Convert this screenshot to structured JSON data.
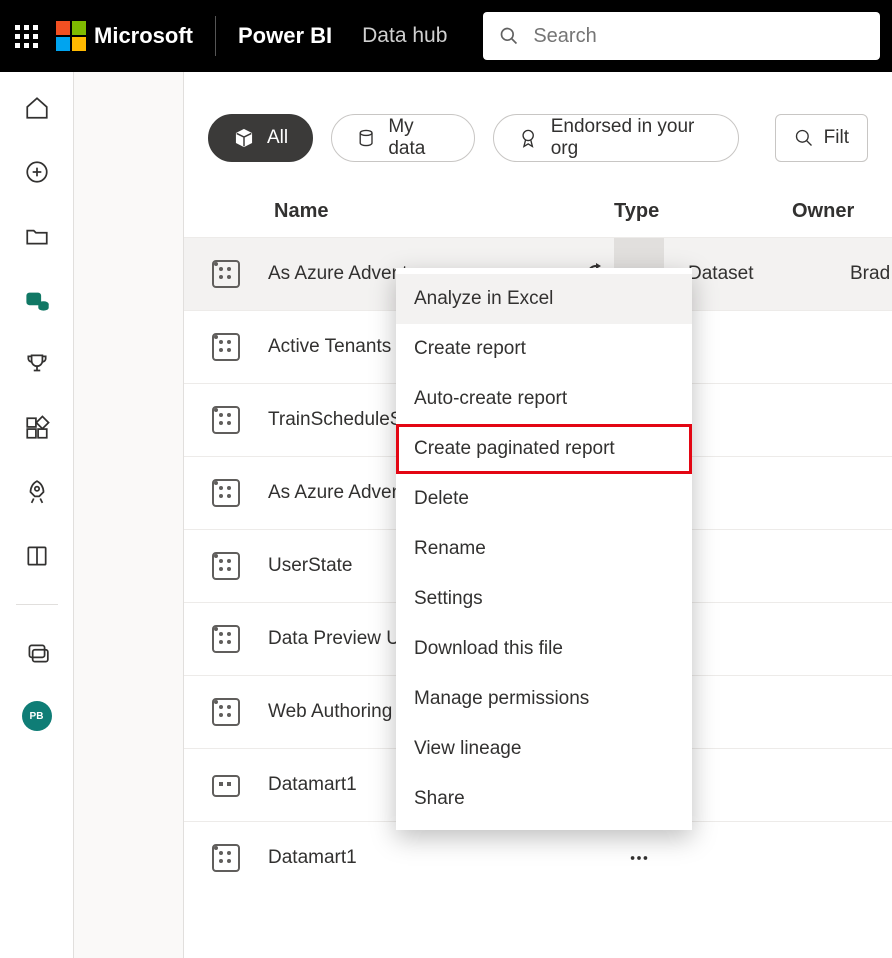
{
  "header": {
    "brand": "Microsoft",
    "app": "Power BI",
    "section": "Data hub",
    "search_placeholder": "Search"
  },
  "leftrail": {
    "avatar_initials": "PB"
  },
  "filters": {
    "all": "All",
    "mydata": "My data",
    "endorsed": "Endorsed in your org",
    "filter_label": "Filt"
  },
  "columns": {
    "name": "Name",
    "type": "Type",
    "owner": "Owner"
  },
  "rows": [
    {
      "name": "As Azure Adventure …",
      "type": "Dataset",
      "owner": "Brad S",
      "icon": "dataset",
      "hovered": true,
      "show_refresh": true,
      "show_more_active": true
    },
    {
      "name": "Active Tenants & Renders",
      "type": "",
      "owner": "",
      "icon": "dataset"
    },
    {
      "name": "TrainScheduleStatus",
      "type": "",
      "owner": "",
      "icon": "dataset"
    },
    {
      "name": "As Azure Adventure Works II",
      "type": "",
      "owner": "",
      "icon": "dataset"
    },
    {
      "name": "UserState",
      "type": "",
      "owner": "",
      "icon": "dataset"
    },
    {
      "name": "Data Preview Usage",
      "type": "",
      "owner": "",
      "icon": "dataset"
    },
    {
      "name": "Web Authoring Usage",
      "type": "",
      "owner": "",
      "icon": "dataset"
    },
    {
      "name": "Datamart1",
      "type": "",
      "owner": "",
      "icon": "datamart"
    },
    {
      "name": "Datamart1",
      "type": "",
      "owner": "",
      "icon": "dataset"
    }
  ],
  "context_menu": {
    "items": [
      {
        "label": "Analyze in Excel",
        "hover": true
      },
      {
        "label": "Create report"
      },
      {
        "label": "Auto-create report"
      },
      {
        "label": "Create paginated report",
        "highlighted": true
      },
      {
        "label": "Delete"
      },
      {
        "label": "Rename"
      },
      {
        "label": "Settings"
      },
      {
        "label": "Download this file"
      },
      {
        "label": "Manage permissions"
      },
      {
        "label": "View lineage"
      },
      {
        "label": "Share"
      }
    ]
  }
}
